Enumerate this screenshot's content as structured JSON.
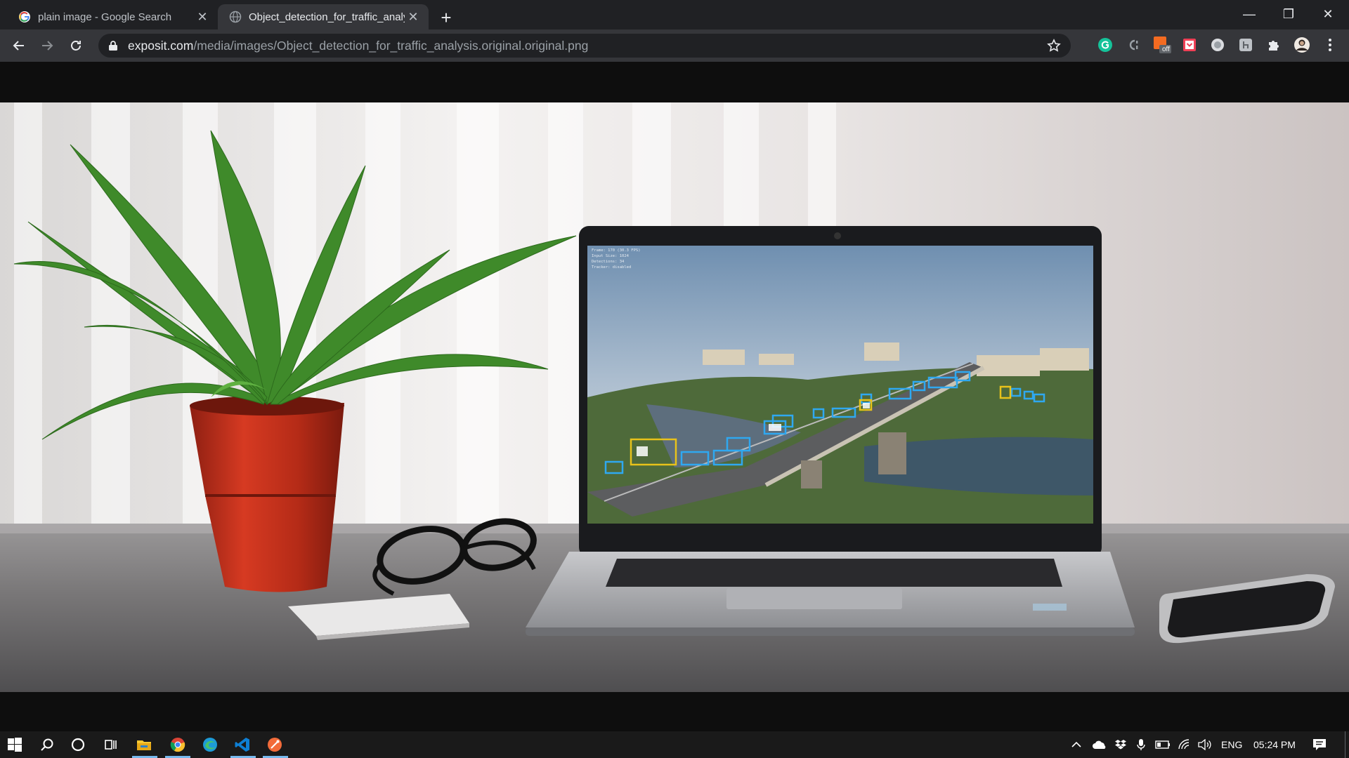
{
  "browser": {
    "tabs": [
      {
        "title": "plain image - Google Search",
        "close": "✕",
        "icon": "google-icon",
        "active": false
      },
      {
        "title": "Object_detection_for_traffic_analysis.original.original.png",
        "close": "✕",
        "icon": "globe-icon",
        "active": true
      }
    ],
    "new_tab": "+",
    "window_controls": {
      "minimize": "—",
      "restore": "❐",
      "close": "✕"
    },
    "url_host": "exposit.com",
    "url_path": "/media/images/Object_detection_for_traffic_analysis.original.original.png",
    "extensions": [
      {
        "name": "grammarly-icon",
        "color": "#15c39a"
      },
      {
        "name": "ci-extension-icon",
        "color": "#9aa0a6"
      },
      {
        "name": "off-badge-icon",
        "color": "#f36b21",
        "badge": "off"
      },
      {
        "name": "pocket-icon",
        "color": "#ef4056"
      },
      {
        "name": "circle-extension-icon",
        "color": "#dadce0"
      },
      {
        "name": "image-extension-icon",
        "color": "#bdc1c6"
      },
      {
        "name": "extensions-puzzle-icon",
        "color": "#e8eaed"
      },
      {
        "name": "profile-avatar",
        "color": "#c9b29b"
      },
      {
        "name": "menu-kebab-icon",
        "color": "#e8eaed"
      }
    ]
  },
  "image": {
    "screen_overlay_lines": [
      "Frame: 170 (30.3 FPS)",
      "Input Size: 1024",
      "Detections: 34",
      "Tracker: disabled"
    ],
    "colors": {
      "vehicle_box": "#2fa8f0",
      "bus_truck_box": "#e8c21a",
      "pot": "#c0321f",
      "leaves": "#3f8a2a"
    }
  },
  "taskbar": {
    "apps": [
      "start-icon",
      "search-icon",
      "cortana-icon",
      "task-view-icon",
      "file-explorer-icon",
      "chrome-icon",
      "edge-icon",
      "vscode-icon",
      "postman-icon"
    ],
    "language": "ENG",
    "time": "05:24 PM"
  }
}
